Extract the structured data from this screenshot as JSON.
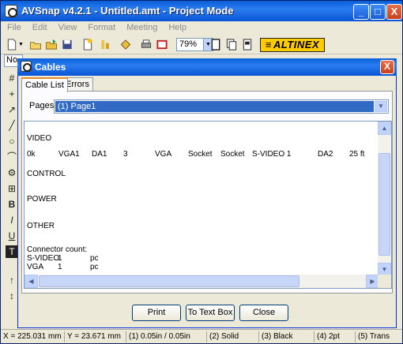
{
  "app": {
    "title": "AVSnap v4.2.1 - Untitled.amt - Project Mode",
    "caption_buttons": {
      "minimize": "_",
      "maximize": "□",
      "close": "X"
    }
  },
  "menu": [
    "File",
    "Edit",
    "View",
    "Format",
    "Meeting",
    "Help"
  ],
  "toolbar": {
    "zoom_value": "79%",
    "brand_logo": "ALTINEX",
    "icons": [
      "new-icon",
      "open-icon",
      "open-folder-icon",
      "save-icon",
      "new-page-icon",
      "arrange-icon",
      "component-icon",
      "print-icon",
      "stop-icon",
      "page-icon",
      "copy-page-icon",
      "page-setup-icon"
    ]
  },
  "row2": {
    "left_box_value": "No"
  },
  "left_tools": [
    "#",
    "+",
    "↗",
    "╱",
    "○",
    "⌒",
    "⚙",
    "⊞",
    "B",
    "I",
    "U",
    "T",
    "↑",
    "↕"
  ],
  "dialog": {
    "title": "Cables",
    "close_glyph": "X",
    "tabs": [
      "Cable List",
      "Errors"
    ],
    "pages_label": "Pages:",
    "pages_value": "(1) Page1",
    "report": {
      "sections": {
        "video": "VIDEO",
        "control": "CONTROL",
        "power": "POWER",
        "other": "OTHER"
      },
      "video_row": [
        "0k",
        "VGA1",
        "DA1",
        "3",
        "VGA",
        "Socket",
        "Socket",
        "S-VIDEO 1",
        "DA2",
        "25 ft"
      ],
      "connector_count_label": "Connector count:",
      "connector_rows": [
        {
          "name": "S-VIDEO",
          "count": "1",
          "unit": "pc"
        },
        {
          "name": "VGA",
          "count": "1",
          "unit": "pc"
        }
      ]
    },
    "buttons": {
      "print": "Print",
      "to_text_box": "To Text Box",
      "close": "Close"
    }
  },
  "status": {
    "x": "X = 225.031 mm",
    "y": "Y = 23.671 mm",
    "grid": "(1) 0.05in / 0.05in",
    "line": "(2) Solid",
    "color": "(3) Black",
    "width": "(4) 2pt",
    "fill": "(5) Trans"
  }
}
